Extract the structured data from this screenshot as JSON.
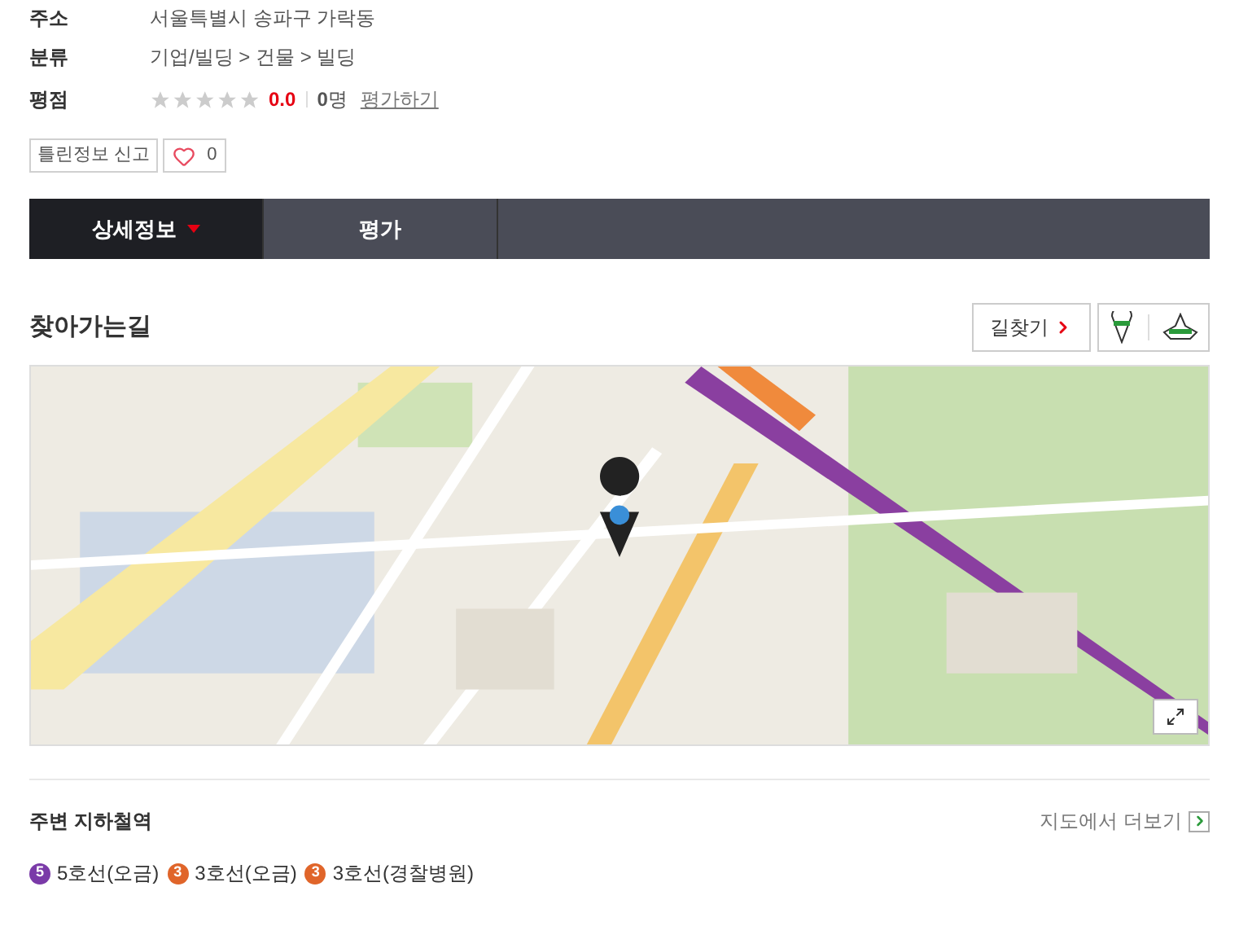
{
  "info": [
    {
      "label": "주소",
      "value": "서울특별시 송파구 가락동"
    },
    {
      "label": "분류",
      "value": "기업/빌딩 > 건물 > 빌딩"
    }
  ],
  "rating": {
    "label": "평점",
    "stars": 0,
    "score": "0.0",
    "count": "0",
    "count_unit": "명",
    "rate_link": "평가하기"
  },
  "report_button": "틀린정보 신고",
  "like_count": "0",
  "tabs": [
    {
      "label": "상세정보",
      "selected": true
    },
    {
      "label": "평가",
      "selected": false
    }
  ],
  "directions": {
    "title": "찾아가는길",
    "route_button": "길찾기"
  },
  "subway": {
    "title": "주변 지하철역",
    "more_link": "지도에서 더보기",
    "stations": [
      {
        "line": "5",
        "name": "5호선(오금)",
        "color": "#7a3aa8"
      },
      {
        "line": "3",
        "name": "3호선(오금)",
        "color": "#e0652a"
      },
      {
        "line": "3",
        "name": "3호선(경찰병원)",
        "color": "#e0652a"
      }
    ]
  }
}
